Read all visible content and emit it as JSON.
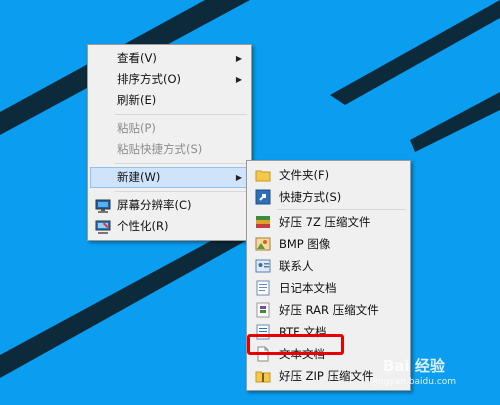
{
  "context_menu": {
    "items": [
      {
        "label": "查看(V)"
      },
      {
        "label": "排序方式(O)"
      },
      {
        "label": "刷新(E)"
      },
      {
        "label": "粘贴(P)"
      },
      {
        "label": "粘贴快捷方式(S)"
      },
      {
        "label": "新建(W)"
      },
      {
        "label": "屏幕分辨率(C)"
      },
      {
        "label": "个性化(R)"
      }
    ]
  },
  "new_submenu": {
    "items": [
      {
        "label": "文件夹(F)",
        "icon": "folder-icon"
      },
      {
        "label": "快捷方式(S)",
        "icon": "shortcut-icon"
      },
      {
        "label": "好压 7Z 压缩文件",
        "icon": "archive-7z-icon"
      },
      {
        "label": "BMP 图像",
        "icon": "bitmap-icon"
      },
      {
        "label": "联系人",
        "icon": "contact-icon"
      },
      {
        "label": "日记本文档",
        "icon": "journal-icon"
      },
      {
        "label": "好压 RAR 压缩文件",
        "icon": "archive-rar-icon"
      },
      {
        "label": "RTF 文档",
        "icon": "rtf-document-icon"
      },
      {
        "label": "文本文档",
        "icon": "text-document-icon"
      },
      {
        "label": "好压 ZIP 压缩文件",
        "icon": "archive-zip-icon"
      }
    ]
  },
  "watermark": {
    "brand": "Bai 经验",
    "url": "jingyan.baidu.com"
  },
  "colors": {
    "desktop": "#0a9df0",
    "menu_bg": "#f0f0f0",
    "highlight": "#cfe3fb",
    "annotation": "#e60000"
  }
}
